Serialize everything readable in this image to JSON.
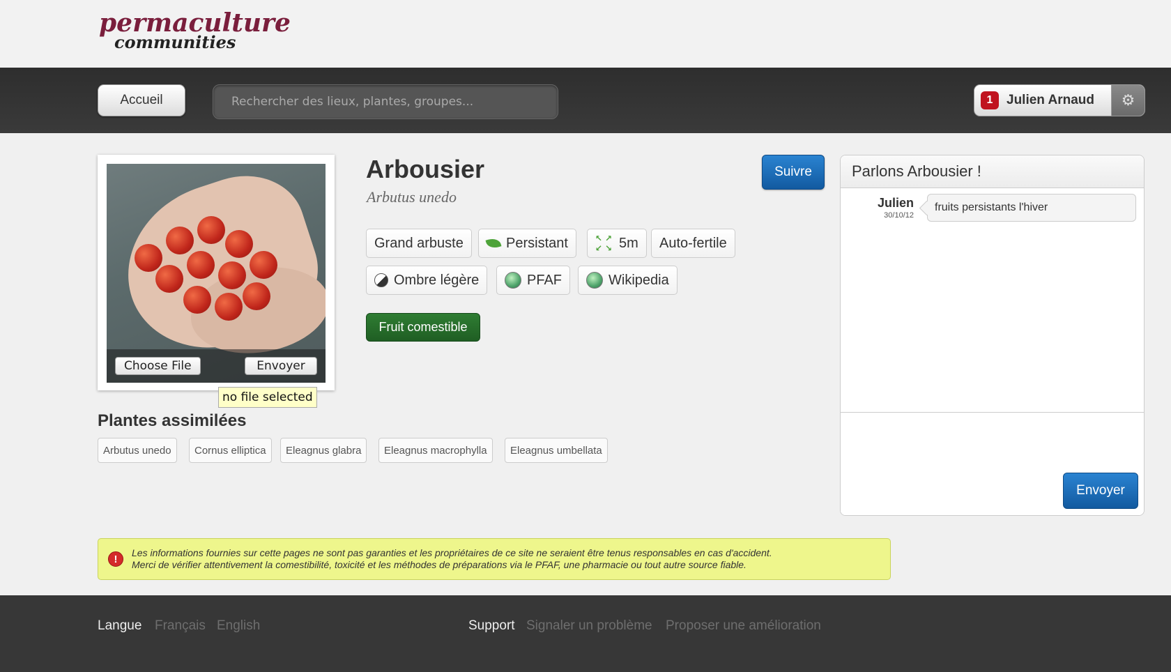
{
  "logo": {
    "line1": "permaculture",
    "line2": "communities"
  },
  "nav": {
    "home_label": "Accueil",
    "search_placeholder": "Rechercher des lieux, plantes, groupes...",
    "user": {
      "notifications": "1",
      "name": "Julien Arnaud"
    }
  },
  "photo": {
    "choose_file_label": "Choose File",
    "upload_label": "Envoyer",
    "file_status": "no file selected"
  },
  "plant": {
    "name": "Arbousier",
    "latin": "Arbutus unedo",
    "follow_label": "Suivre",
    "tags": [
      {
        "label": "Grand arbuste"
      },
      {
        "label": "Persistant",
        "icon": "leaf-icon"
      },
      {
        "label": "5m",
        "icon": "expand-icon"
      },
      {
        "label": "Auto-fertile"
      },
      {
        "label": "Ombre légère",
        "icon": "shade-icon"
      },
      {
        "label": "PFAF",
        "icon": "globe-icon"
      },
      {
        "label": "Wikipedia",
        "icon": "globe-icon"
      }
    ],
    "use_badge": "Fruit comestible"
  },
  "similar": {
    "title": "Plantes assimilées",
    "items": [
      "Arbutus unedo",
      "Cornus elliptica",
      "Eleagnus glabra",
      "Eleagnus macrophylla",
      "Eleagnus umbellata"
    ]
  },
  "chat": {
    "title": "Parlons Arbousier !",
    "messages": [
      {
        "author": "Julien",
        "date": "30/10/12",
        "text": "fruits persistants l'hiver"
      }
    ],
    "send_label": "Envoyer"
  },
  "warning": {
    "line1": "Les informations fournies sur cette pages ne sont pas garanties et les propriétaires de ce site ne seraient être tenus responsables en cas d'accident.",
    "line2": "Merci de vérifier attentivement la comestibilité, toxicité et les méthodes de préparations via le PFAF, une pharmacie ou tout autre source fiable."
  },
  "footer": {
    "lang_label": "Langue",
    "lang_options": [
      "Français",
      "English"
    ],
    "support_label": "Support",
    "support_links": [
      "Signaler un problème",
      "Proposer une amélioration"
    ]
  },
  "colors": {
    "accent_blue": "#1a6cb8",
    "brand": "#7a1e3c",
    "badge_green": "#2a6e2e",
    "warning_bg": "#eef68c",
    "notification_red": "#c0131f"
  }
}
